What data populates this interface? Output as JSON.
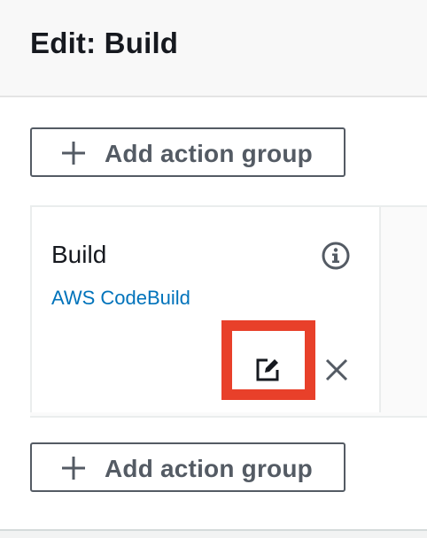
{
  "header": {
    "title": "Edit: Build"
  },
  "toolbar": {
    "add_group_top_label": "Add action group",
    "add_group_bottom_label": "Add action group"
  },
  "stage_card": {
    "title": "Build",
    "provider_link": "AWS CodeBuild",
    "icons": {
      "info": "info-icon",
      "edit": "edit-icon",
      "remove": "close-icon"
    }
  },
  "colors": {
    "highlight": "#e8402a",
    "link": "#0073bb",
    "button_border": "#545b64",
    "title_text": "#16191f"
  }
}
